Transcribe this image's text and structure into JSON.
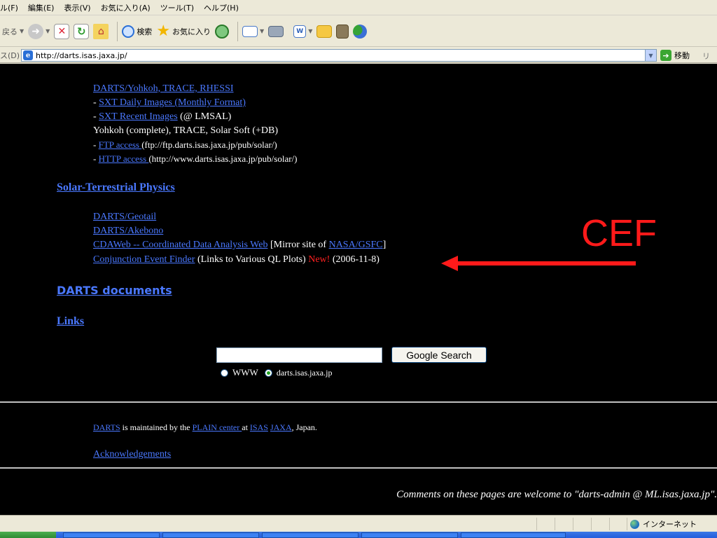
{
  "menu": {
    "items": [
      "ル(F)",
      "編集(E)",
      "表示(V)",
      "お気に入り(A)",
      "ツール(T)",
      "ヘルプ(H)"
    ]
  },
  "toolbar": {
    "back_label": "戻る",
    "search_label": "検索",
    "favorites_label": "お気に入り",
    "icons": [
      "back-icon",
      "forward-icon",
      "stop-icon",
      "refresh-icon",
      "home-icon",
      "search-icon",
      "favorites-star-icon",
      "history-icon",
      "mail-icon",
      "print-icon",
      "edit-icon",
      "folder-icon",
      "research-icon",
      "messenger-icon"
    ]
  },
  "address_bar": {
    "label": "ス(D)",
    "url": "http://darts.isas.jaxa.jp/",
    "go_label": "移動",
    "links_label": "リン"
  },
  "content": {
    "solar": {
      "yohkoh_link": "DARTS/Yohkoh, TRACE, RHESSI",
      "sxt_daily_prefix": "- ",
      "sxt_daily_link": "SXT Daily Images (Monthly Format)",
      "sxt_recent_prefix": "- ",
      "sxt_recent_link": "SXT Recent Images",
      "sxt_recent_suffix": " (@ LMSAL)",
      "yohkoh_desc": "Yohkoh (complete), TRACE, Solar Soft (+DB)",
      "ftp_prefix": "- ",
      "ftp_link": "FTP access ",
      "ftp_suffix": "(ftp://ftp.darts.isas.jaxa.jp/pub/solar/)",
      "http_prefix": "- ",
      "http_link": "HTTP access ",
      "http_suffix": "(http://www.darts.isas.jaxa.jp/pub/solar/)"
    },
    "stp": {
      "heading": "Solar-Terrestrial Physics",
      "geotail_link": "DARTS/Geotail",
      "akebono_link": "DARTS/Akebono",
      "cdaweb_link": "CDAWeb -- Coordinated Data Analysis Web",
      "cdaweb_mirror_prefix": " [Mirror site of ",
      "nasa_link": "NASA/GSFC",
      "cdaweb_mirror_suffix": "]",
      "cef_link": "Conjunction Event Finder",
      "cef_desc": " (Links to Various QL Plots) ",
      "new_label": "New!",
      "cef_date": " (2006-11-8)"
    },
    "annotation": {
      "label": "CEF",
      "color": "#ff1a1a"
    },
    "documents_heading": "DARTS documents",
    "links_heading": "Links",
    "search": {
      "input_value": "",
      "button_label": "Google Search",
      "option_www": "WWW",
      "option_site": "darts.isas.jaxa.jp",
      "selected": "darts.isas.jaxa.jp"
    },
    "footer": {
      "darts_link": "DARTS",
      "maintained_text": " is maintained by the ",
      "plain_link": "PLAIN center ",
      "at_text": "at ",
      "isas_link": "ISAS",
      "space": " ",
      "jaxa_link": "JAXA",
      "japan_text": ", Japan.",
      "ack_link": "Acknowledgements",
      "comments_text": "Comments on these pages are welcome to \"darts-admin @ ML.isas.jaxa.jp\"."
    }
  },
  "status_bar": {
    "zone_label": "インターネット"
  },
  "colors": {
    "link": "#4a78ff",
    "background": "#000000",
    "new_badge": "#ff2020",
    "chrome": "#ece9d8"
  }
}
